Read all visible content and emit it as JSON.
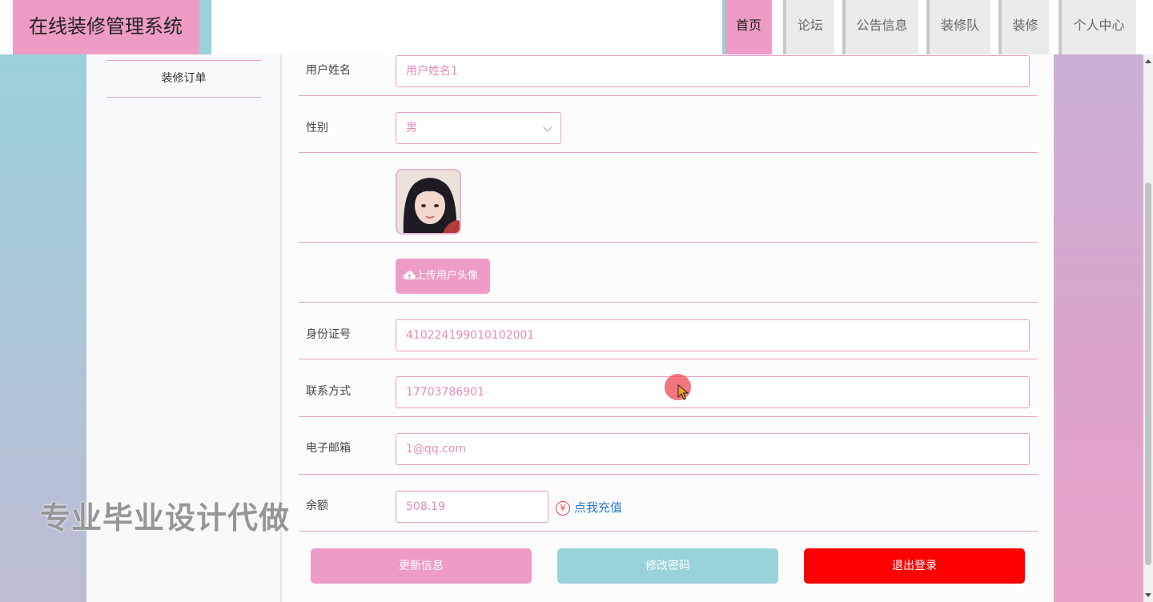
{
  "app": {
    "title": "在线装修管理系统",
    "nav": [
      {
        "label": "首页",
        "active": true
      },
      {
        "label": "论坛",
        "active": false
      },
      {
        "label": "公告信息",
        "active": false
      },
      {
        "label": "装修队",
        "active": false
      },
      {
        "label": "装修",
        "active": false
      },
      {
        "label": "个人中心",
        "active": false
      }
    ]
  },
  "sidebar": {
    "items": [
      {
        "label": "装修订单"
      }
    ]
  },
  "form": {
    "name": {
      "label": "用户姓名",
      "value": "用户姓名1"
    },
    "gender": {
      "label": "性别",
      "value": "男"
    },
    "avatar": {
      "icon": "avatar-photo"
    },
    "upload": {
      "label": "上传用户头像",
      "icon": "cloud-upload-icon"
    },
    "id_card": {
      "label": "身份证号",
      "value": "410224199010102001"
    },
    "phone": {
      "label": "联系方式",
      "value": "17703786901"
    },
    "email": {
      "label": "电子邮箱",
      "value": "1@qq.com"
    },
    "balance": {
      "label": "余额",
      "value": "508.19",
      "recharge_label": "点我充值",
      "currency_icon": "¥"
    }
  },
  "actions": {
    "update": "更新信息",
    "change_password": "修改密码",
    "logout": "退出登录"
  },
  "overlay": {
    "watermark": "专业毕业设计代做"
  },
  "colors": {
    "primary": "#ee9cc6",
    "secondary": "#98d3da",
    "danger": "#ff0000",
    "link": "#2a78c9"
  }
}
